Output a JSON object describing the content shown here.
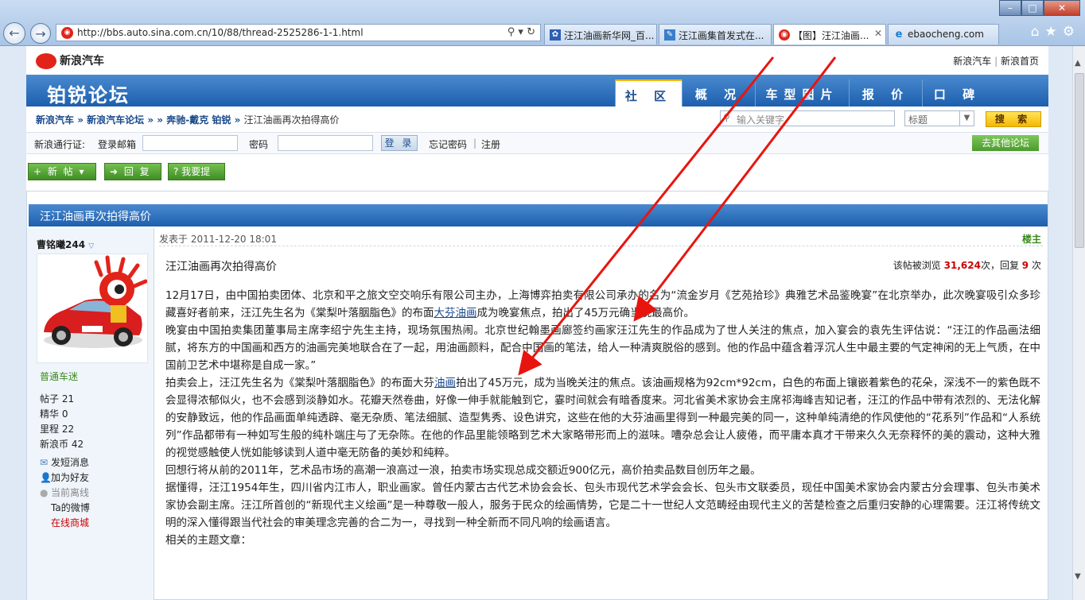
{
  "browser": {
    "url": "http://bbs.auto.sina.com.cn/10/88/thread-2525286-1-1.html",
    "tabs": [
      {
        "label": "汪江油画新华网_百...",
        "active": false
      },
      {
        "label": "汪江画集首发式在...",
        "active": false
      },
      {
        "label": "【图】汪江油画...",
        "active": true
      },
      {
        "label": "ebaocheng.com",
        "active": false
      }
    ],
    "window_controls": [
      "–",
      "□",
      "✕"
    ],
    "accent": "#1d5fad"
  },
  "site": {
    "logo": "新浪汽车",
    "top_links": [
      "新浪汽车",
      "新浪首页"
    ],
    "forum_title": "铂锐论坛",
    "nav": [
      "社 区",
      "概 况",
      "车型图片",
      "报 价",
      "口 碑"
    ]
  },
  "breadcrumb": {
    "items": [
      "新浪汽车",
      "新浪汽车论坛",
      "奔驰-戴克 铂锐"
    ],
    "separators": [
      "»",
      "» »",
      "»"
    ],
    "current": "汪江油画再次拍得高价"
  },
  "search": {
    "placeholder": "输入关键字",
    "select_value": "标题",
    "button": "搜 索"
  },
  "login": {
    "label": "新浪通行证:",
    "email_label": "登录邮箱",
    "password_label": "密码",
    "login_button": "登 录",
    "forgot": "忘记密码",
    "sep": "|",
    "register": "注册",
    "other_forums": "去其他论坛"
  },
  "actions": {
    "new_post": "+ 新 帖",
    "new_post_arrow": "▾",
    "reply": "➜ 回 复",
    "ask": "? 我要提问"
  },
  "thread": {
    "header": "汪江油画再次拍得高价",
    "author": "曹铭曦244",
    "user_rank": "普通车迷",
    "stats": [
      {
        "label": "帖子",
        "value": "21"
      },
      {
        "label": "精华",
        "value": "0"
      },
      {
        "label": "里程",
        "value": "22"
      },
      {
        "label": "新浪币",
        "value": "42"
      }
    ],
    "user_links": [
      "发短消息",
      "加为好友",
      "当前离线",
      "Ta的微博",
      "在线商城"
    ],
    "posted_at": "发表于 2011-12-20 18:01",
    "floor": "楼主",
    "title": "汪江油画再次拍得高价",
    "view_prefix": "该帖被浏览",
    "views": "31,624",
    "view_mid": "次，回复",
    "replies": "9",
    "view_suffix": "次",
    "paragraphs": [
      {
        "pre": "12月17日，由中国拍卖团体、北京和平之旅文空交响乐有限公司主办，上海博弈拍卖有限公司承办的名为“流金岁月《艺苑拾珍》典雅艺术品鉴晚宴”在北京举办，此次晚宴吸引众多珍藏喜好者前来，汪江先生名为《棠梨叶落胭脂色》的布面",
        "link": "大芬油画",
        "post": "成为晚宴焦点，拍出了45万元确当晚最高价。"
      },
      {
        "pre": "晚宴由中国拍卖集团董事局主席李绍宁先生主持，现场氛围热闹。北京世纪翰墨画廊签约画家汪江先生的作品成为了世人关注的焦点，加入宴会的袁先生评估说：“汪江的作品画法细腻，将东方的中国画和西方的油画完美地联合在了一起，用油画颜料，配合中国画的笔法，给人一种清爽脱俗的感到。他的作品中蕴含着浮沉人生中最主要的气定神闲的无上气质，在中国前卫艺术中堪称是自成一家。”",
        "link": "",
        "post": ""
      },
      {
        "pre": "拍卖会上，汪江先生名为《棠梨叶落胭脂色》的布面大芬",
        "link": "油画",
        "post": "拍出了45万元，成为当晚关注的焦点。该油画规格为92cm*92cm，白色的布面上镶嵌着紫色的花朵，深浅不一的紫色既不会显得浓郁似火，也不会感到淡静如水。花瓣天然卷曲，好像一伸手就能触到它，霎时间就会有暗香度来。河北省美术家协会主席祁海峰吉知记者，汪江的作品中带有浓烈的、无法化解的安静致远，他的作品画面单纯透辟、毫无杂质、笔法细腻、造型隽秀、设色讲究，这些在他的大芬油画里得到一种最完美的同一，这种单纯清绝的作风使他的“花系列”作品和“人系统列”作品都带有一种如写生般的纯朴端庄与了无杂陈。在他的作品里能领略到艺术大家略带形而上的滋味。嘈杂总会让人疲倦，而平庸本真才干带来久久无奈释怀的美的震动，这种大雅的视觉感触使人恍如能够读到人道中毫无防备的美妙和纯粹。"
      },
      {
        "pre": "回想行将从前的2011年，艺术品市场的高潮一浪高过一浪，拍卖市场实现总成交额近900亿元，高价拍卖品数目创历年之最。",
        "link": "",
        "post": ""
      },
      {
        "pre": "据懂得，汪江1954年生，四川省内江市人，职业画家。曾任内蒙古古代艺术协会会长、包头市现代艺术学会会长、包头市文联委员，现任中国美术家协会内蒙古分会理事、包头市美术家协会副主席。汪江所首创的“新现代主义绘画”是一种尊敬一般人，服务于民众的绘画情势，它是二十一世纪人文范畴经由现代主义的苦楚检查之后重归安静的心理需要。汪江将传统文明的深入懂得跟当代社会的审美理念完善的合二为一，寻找到一种全新而不同凡响的绘画语言。",
        "link": "",
        "post": ""
      },
      {
        "pre": "相关的主题文章：",
        "link": "",
        "post": ""
      }
    ]
  },
  "annotation_color": "#e8150f"
}
